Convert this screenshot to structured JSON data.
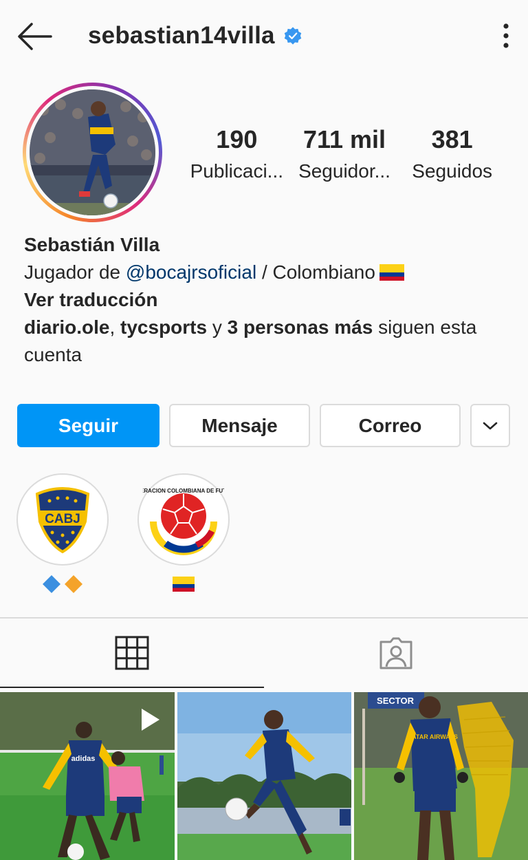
{
  "header": {
    "username": "sebastian14villa",
    "back_icon": "arrow-left-icon",
    "verified_icon": "verified-badge-icon",
    "more_icon": "more-vertical-icon"
  },
  "stats": [
    {
      "value": "190",
      "label": "Publicaci..."
    },
    {
      "value": "711 mil",
      "label": "Seguidor..."
    },
    {
      "value": "381",
      "label": "Seguidos"
    }
  ],
  "bio": {
    "name": "Sebastián Villa",
    "line1_prefix": "Jugador de ",
    "mention": "@bocajrsoficial",
    "line1_suffix": " / Colombiano",
    "translate": "Ver traducción",
    "followed_by_1": "diario.ole",
    "followed_sep1": ", ",
    "followed_by_2": "tycsports",
    "followed_sep2": " y ",
    "followed_more": "3 personas más",
    "followed_suffix": " siguen esta cuenta"
  },
  "buttons": {
    "follow": "Seguir",
    "message": "Mensaje",
    "email": "Correo",
    "more_icon": "chevron-down-icon"
  },
  "highlights": [
    {
      "name": "boca-juniors",
      "crest_text": "CABJ",
      "label_icons": [
        "blue-diamond",
        "orange-diamond"
      ]
    },
    {
      "name": "colombia",
      "crest_text": "FEDERACION COLOMBIANA DE FUTBOL",
      "label_icons": [
        "colombia-flag"
      ]
    }
  ],
  "tabs": [
    {
      "name": "posts-grid",
      "icon": "grid-icon",
      "active": true
    },
    {
      "name": "tagged",
      "icon": "tagged-person-icon",
      "active": false
    }
  ],
  "posts": [
    {
      "type": "reel",
      "jersey_text": "adidas"
    },
    {
      "type": "photo"
    },
    {
      "type": "photo",
      "sign_text": "SECTOR",
      "jersey_text": "QATAR AIRWAYS"
    }
  ],
  "colors": {
    "accent": "#0095f6",
    "mention": "#00376b",
    "boca_blue": "#1d3a7a",
    "boca_gold": "#f5c000"
  }
}
